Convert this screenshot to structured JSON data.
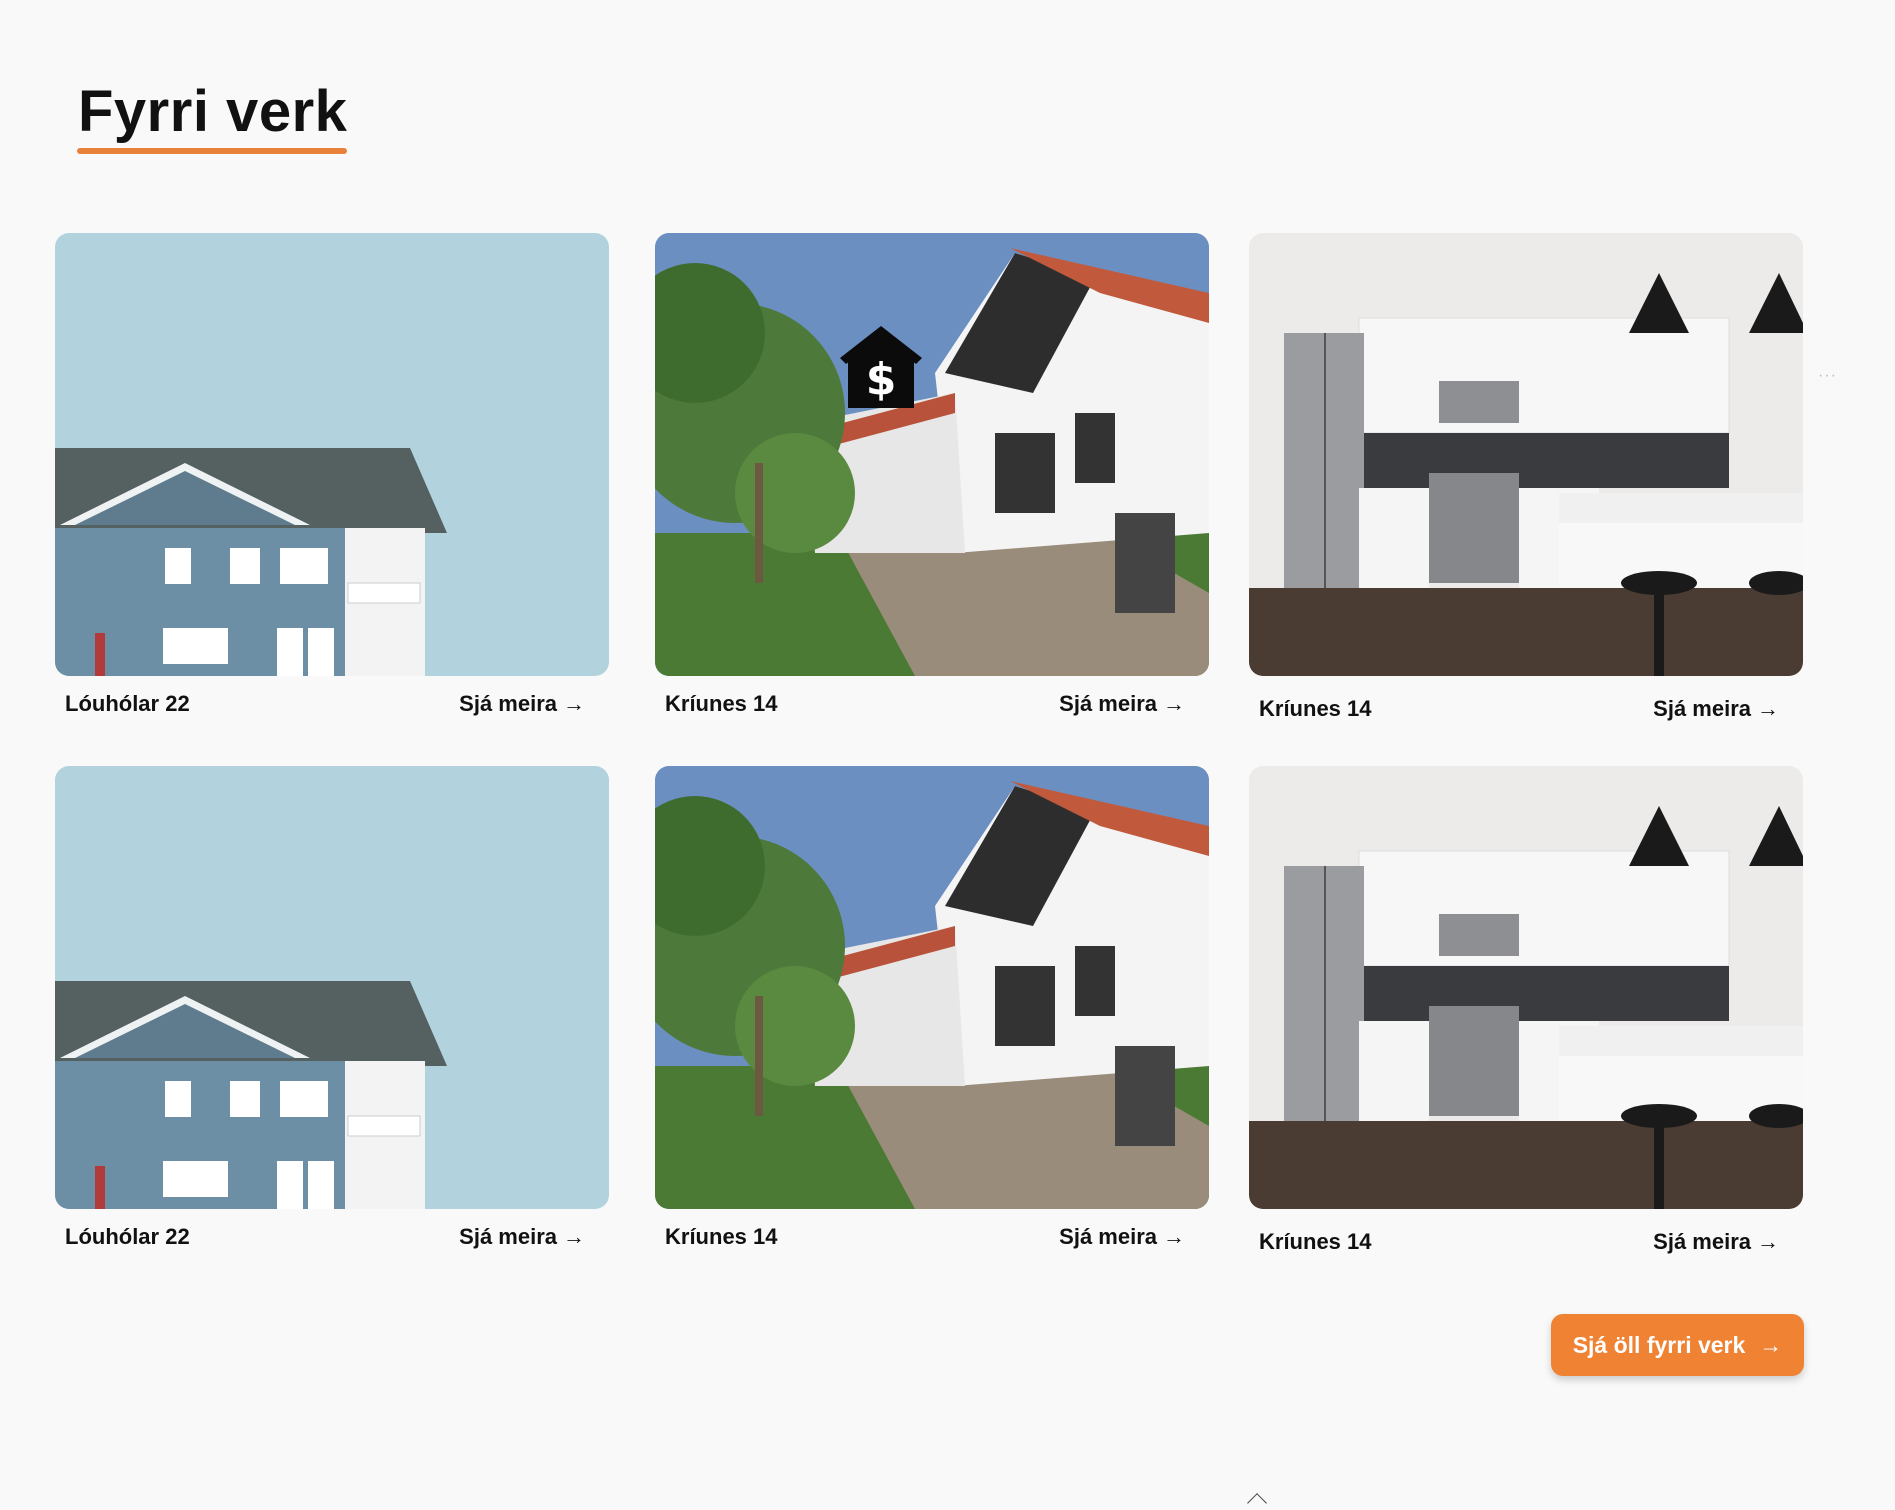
{
  "section": {
    "title": "Fyrri verk"
  },
  "projects": [
    {
      "name": "Lóuhólar 22",
      "link": "Sjá meira",
      "image": "blue-house-photo"
    },
    {
      "name": "Kríunes 14",
      "link": "Sjá meira",
      "image": "townhouse-garden-photo"
    },
    {
      "name": "Kríunes 14",
      "link": "Sjá meira",
      "image": "white-kitchen-photo"
    },
    {
      "name": "Lóuhólar 22",
      "link": "Sjá meira",
      "image": "blue-house-photo"
    },
    {
      "name": "Kríunes 14",
      "link": "Sjá meira",
      "image": "townhouse-garden-photo"
    },
    {
      "name": "Kríunes 14",
      "link": "Sjá meira",
      "image": "white-kitchen-photo"
    }
  ],
  "cta": {
    "label": "Sjá öll fyrri verk",
    "icon": "arrow-right-icon"
  },
  "overlay_icon": "house-dollar-icon",
  "colors": {
    "accent": "#ef8233",
    "underline": "#e8823a",
    "background": "#f9f9f9"
  }
}
